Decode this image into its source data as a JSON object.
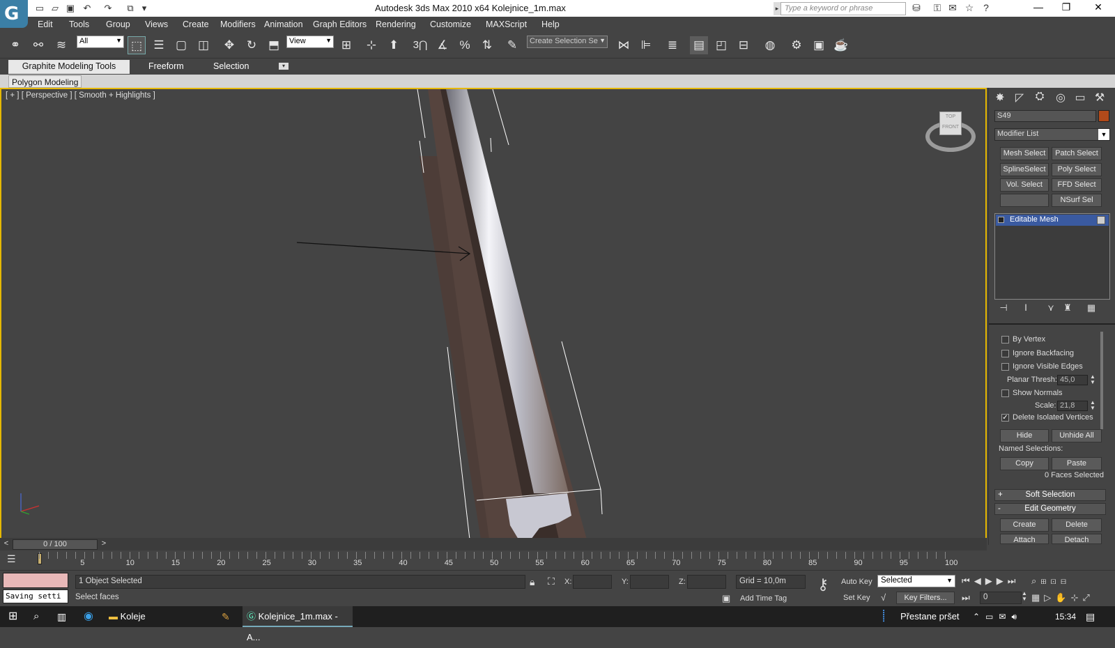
{
  "app": {
    "title": "Autodesk 3ds Max  2010 x64      Kolejnice_1m.max",
    "search_placeholder": "Type a keyword or phrase"
  },
  "menu": [
    "Edit",
    "Tools",
    "Group",
    "Views",
    "Create",
    "Modifiers",
    "Animation",
    "Graph Editors",
    "Rendering",
    "Customize",
    "MAXScript",
    "Help"
  ],
  "toolbar": {
    "selection_filter": "All",
    "ref_coord": "View",
    "named_selection": "Create Selection Se",
    "snap_label": "3"
  },
  "ribbon": {
    "tabs": [
      "Graphite Modeling Tools",
      "Freeform",
      "Selection"
    ],
    "sub": "Polygon Modeling"
  },
  "viewport": {
    "label": "[ + ] [ Perspective ] [ Smooth + Highlights ]",
    "viewcube": "FRONT",
    "viewcube_top": "TOP"
  },
  "cmd": {
    "object_name": "S49",
    "object_color": "#b24a1a",
    "modifier_list": "Modifier List",
    "mod_buttons": [
      "Mesh Select",
      "Patch Select",
      "SplineSelect",
      "Poly Select",
      "Vol. Select",
      "FFD Select",
      "",
      "NSurf Sel"
    ],
    "stack_item": "Editable Mesh",
    "by_vertex": "By Vertex",
    "ignore_backfacing": "Ignore Backfacing",
    "ignore_visible_edges": "Ignore Visible Edges",
    "planar_thresh_label": "Planar Thresh:",
    "planar_thresh": "45,0",
    "show_normals": "Show Normals",
    "scale_label": "Scale:",
    "scale": "21,8",
    "delete_isolated": "Delete Isolated Vertices",
    "hide": "Hide",
    "unhide_all": "Unhide All",
    "named_selections": "Named Selections:",
    "copy": "Copy",
    "paste": "Paste",
    "faces_selected": "0 Faces Selected",
    "soft_selection": "Soft Selection",
    "edit_geometry": "Edit Geometry",
    "create": "Create",
    "delete": "Delete",
    "attach": "Attach",
    "detach": "Detach"
  },
  "timeline": {
    "frame": "0 / 100",
    "ticks": [
      "5",
      "10",
      "15",
      "20",
      "25",
      "30",
      "35",
      "40",
      "45",
      "50",
      "55",
      "60",
      "65",
      "70",
      "75",
      "80",
      "85",
      "90",
      "95",
      "100"
    ]
  },
  "status": {
    "selected": "1 Object Selected",
    "prompt": "Select faces",
    "saving": "Saving setti",
    "x": "X:",
    "y": "Y:",
    "z": "Z:",
    "grid": "Grid = 10,0m",
    "add_time_tag": "Add Time Tag",
    "auto_key": "Auto Key",
    "set_key": "Set Key",
    "key_mode": "Selected",
    "key_filters": "Key Filters...",
    "frame_field": "0"
  },
  "taskbar": {
    "folder": "Koleje",
    "app": "Kolejnice_1m.max - A...",
    "weather": "Přestane pršet",
    "time": "15:34"
  }
}
